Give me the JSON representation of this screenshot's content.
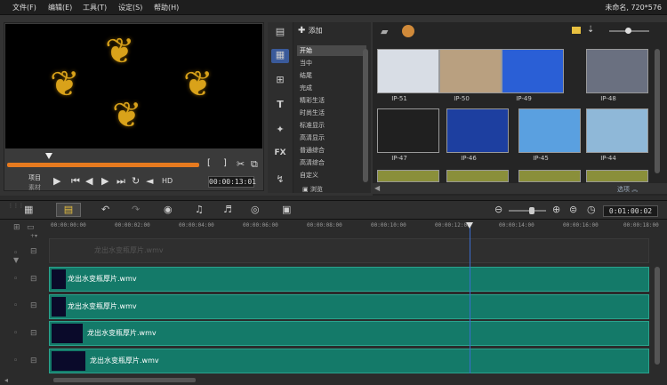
{
  "menu": {
    "file": "文件(F)",
    "edit": "编辑(E)",
    "tools": "工具(T)",
    "settings": "设定(S)",
    "help": "帮助(H)",
    "project_info": "未命名, 720*576"
  },
  "player": {
    "project_label": "项目",
    "clip_label": "素材",
    "hd_label": "HD",
    "timecode": "00:00:13:01"
  },
  "library": {
    "add_label": "添加",
    "categories": [
      "开始",
      "当中",
      "结尾",
      "完成",
      "精彩生活",
      "时尚生活",
      "标准显示",
      "高清显示",
      "普通综合",
      "高清综合",
      "自定义"
    ],
    "browse_label": "浏览",
    "options_label": "选项",
    "thumbnails": [
      {
        "id": "IP-51",
        "color": "#d8dde5"
      },
      {
        "id": "IP-50",
        "color": "#b9a080"
      },
      {
        "id": "IP-49",
        "color": "#2a5fd6"
      },
      {
        "id": "IP-48",
        "color": "#6a7080"
      },
      {
        "id": "IP-47",
        "color": "#202020"
      },
      {
        "id": "IP-46",
        "color": "#1d3fa0"
      },
      {
        "id": "IP-45",
        "color": "#5aa0e0"
      },
      {
        "id": "IP-44",
        "color": "#8fb8d8"
      }
    ]
  },
  "timeline": {
    "timecode": "0:01:00:02",
    "ruler": [
      "00:00:00:00",
      "00:00:02:00",
      "00:00:04:00",
      "00:00:06:00",
      "00:00:08:00",
      "00:00:10:00",
      "00:00:12:00",
      "00:00:14:00",
      "00:00:16:00",
      "00:00:18:00"
    ],
    "ghost_clip": "龙出水变瓶厚片.wmv",
    "clips": [
      "龙出水变瓶厚片.wmv",
      "龙出水变瓶厚片.wmv",
      "龙出水变瓶厚片.wmv",
      "龙出水变瓶厚片.wmv"
    ]
  }
}
